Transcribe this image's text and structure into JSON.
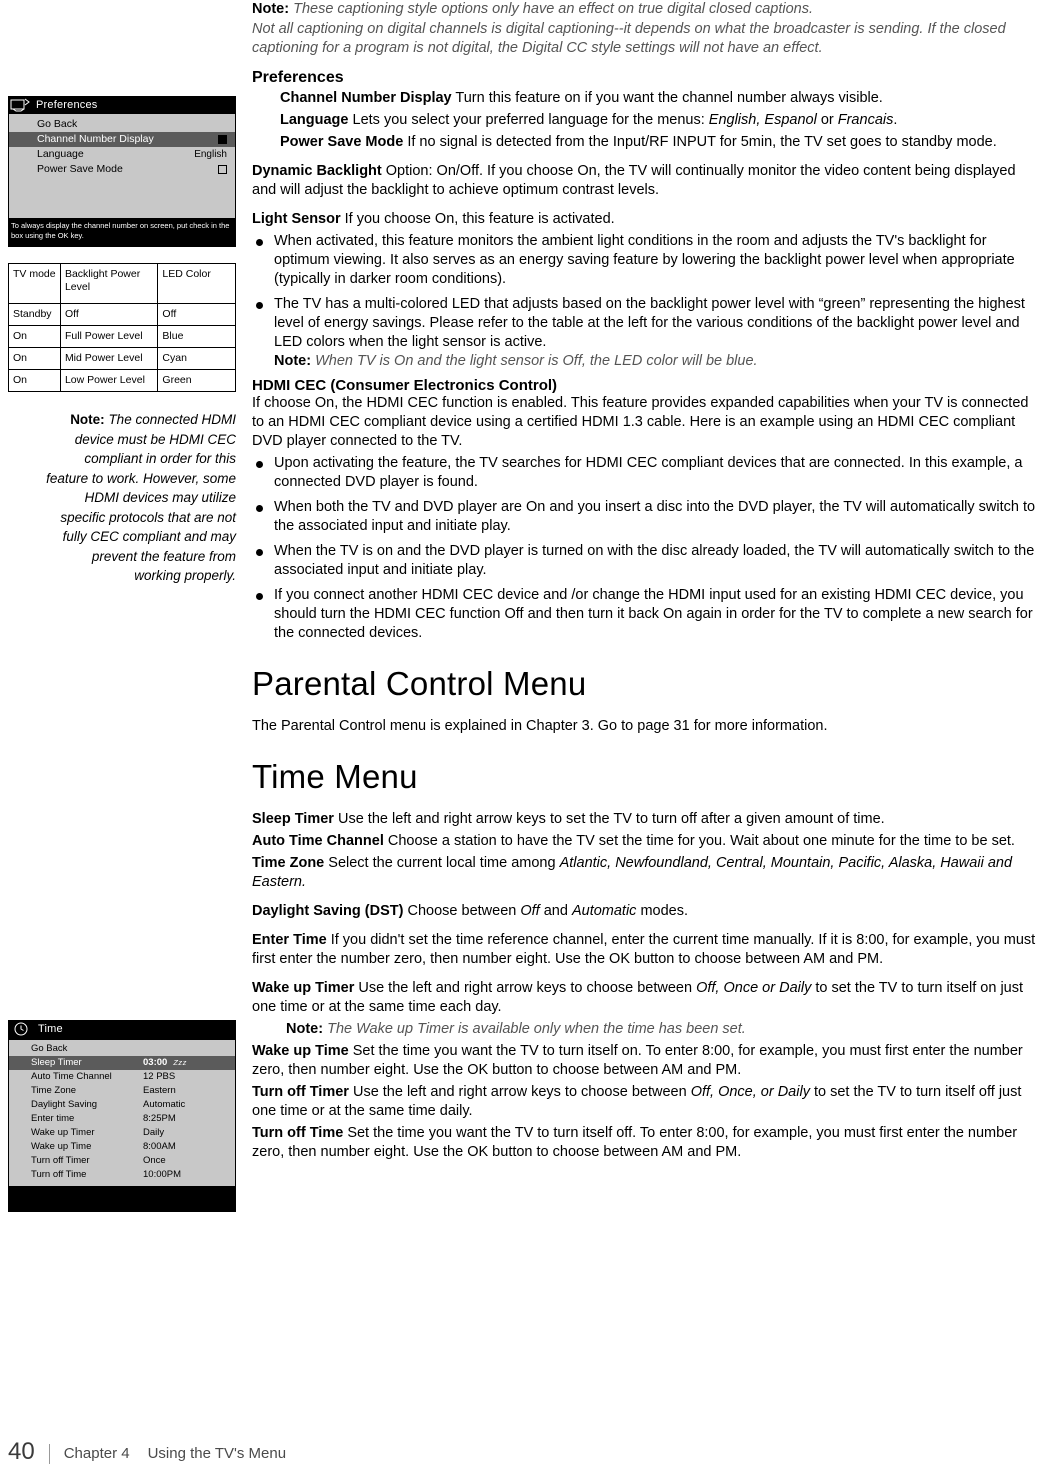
{
  "osd_preferences": {
    "title": "Preferences",
    "icon": "tv-preferences-icon",
    "rows": [
      {
        "label": "Go Back",
        "value": "",
        "selected": false,
        "checkbox": null
      },
      {
        "label": "Channel Number Display",
        "value": "",
        "selected": true,
        "checkbox": "filled"
      },
      {
        "label": "Language",
        "value": "English",
        "selected": false,
        "checkbox": null
      },
      {
        "label": "Power Save Mode",
        "value": "",
        "selected": false,
        "checkbox": "open"
      }
    ],
    "footer": "To always display the channel number on screen, put check in the box using the OK key."
  },
  "tv_table": {
    "headers": [
      "TV mode",
      "Backlight Power Level",
      "LED Color"
    ],
    "rows": [
      [
        "Standby",
        "Off",
        "Off"
      ],
      [
        "On",
        "Full Power Level",
        "Blue"
      ],
      [
        "On",
        "Mid Power Level",
        "Cyan"
      ],
      [
        "On",
        "Low Power Level",
        "Green"
      ]
    ]
  },
  "left_note": {
    "label": "Note:",
    "text": " The connected HDMI device must be HDMI CEC compliant in order for this feature to work. However, some HDMI devices may utilize specific protocols that are not fully CEC compliant and may prevent the feature from working properly."
  },
  "osd_time": {
    "title": "Time",
    "icon": "clock-icon",
    "rows": [
      {
        "key": "Go Back",
        "value": "",
        "selected": false
      },
      {
        "key": "Sleep Timer",
        "value": "03:00",
        "selected": true,
        "suffix": "Zzz"
      },
      {
        "key": "Auto Time Channel",
        "value": "12 PBS",
        "selected": false
      },
      {
        "key": "Time Zone",
        "value": "Eastern",
        "selected": false
      },
      {
        "key": "Daylight Saving",
        "value": "Automatic",
        "selected": false
      },
      {
        "key": "Enter time",
        "value": "8:25PM",
        "selected": false
      },
      {
        "key": "Wake up Timer",
        "value": "Daily",
        "selected": false
      },
      {
        "key": "Wake up Time",
        "value": "8:00AM",
        "selected": false
      },
      {
        "key": "Turn off Timer",
        "value": "Once",
        "selected": false
      },
      {
        "key": "Turn off Time",
        "value": "10:00PM",
        "selected": false
      }
    ]
  },
  "content": {
    "note_top_label": "Note:",
    "note_top_line1": " These captioning style options only have an effect on true digital closed captions.",
    "note_top_line2": "Not all captioning on digital channels is digital captioning--it depends on what the broadcaster is sending. If the closed captioning for a program is not digital, the Digital CC style settings will not have an effect.",
    "preferences_heading": "Preferences",
    "pref_items": [
      {
        "term": "Channel Number Display",
        "desc": "  Turn this feature on if you want the channel number always visible."
      },
      {
        "term": "Language",
        "desc_pre": "   Lets you select your preferred language for the menus: ",
        "desc_it": "English, Espanol",
        "desc_mid": " or ",
        "desc_it2": "Francais",
        "desc_post": "."
      },
      {
        "term": "Power Save Mode",
        "desc": "   If no signal is detected from the Input/RF INPUT for 5min, the TV set goes to standby mode."
      }
    ],
    "dynamic_backlight": {
      "term": "Dynamic Backlight",
      "desc": "   Option: On/Off. If you choose On, the TV will continually monitor the video content being displayed and will adjust the backlight to achieve optimum contrast levels."
    },
    "light_sensor": {
      "term": "Light Sensor",
      "desc": "  If you choose On, this feature is activated.",
      "bullets": [
        "When activated, this feature monitors the ambient light conditions in the room and adjusts the TV's backlight for optimum viewing. It also serves as an energy saving feature by lowering the backlight power level when appropriate (typically in darker room conditions).",
        "The TV has a multi-colored LED that adjusts based on the backlight power level with “green” representing the highest level of energy savings. Please refer to the table at the left for the various conditions of the backlight power level and LED colors when the light sensor is active."
      ],
      "note_label": "Note:",
      "note_text": " When TV is On and the light sensor is Off, the LED color will be blue."
    },
    "hdmi_cec": {
      "heading": "HDMI CEC (Consumer Electronics Control)",
      "intro": "If choose On, the HDMI CEC function is enabled. This feature provides expanded capabilities when your TV is connected to an HDMI CEC compliant device using a certified HDMI 1.3 cable. Here is an example using an HDMI CEC compliant DVD player connected to the TV.",
      "bullets": [
        "Upon activating the feature, the TV searches for HDMI CEC compliant devices that are connected. In this example, a connected DVD player is found.",
        "When both the TV and DVD player are On and you insert a disc into the DVD player, the TV will automatically switch to the associated input and initiate play.",
        "When the TV is on and the DVD player is turned on with the disc already loaded, the TV will automatically switch to the associated input and initiate play.",
        "If you connect another HDMI CEC device and /or change the HDMI input used for an existing HDMI CEC device, you should turn the HDMI CEC function Off and then turn it back On again in order for the TV to complete a new search for the connected devices."
      ]
    },
    "parental_heading": "Parental Control Menu",
    "parental_text": "The Parental Control menu is explained in Chapter 3. Go to page 31 for more information.",
    "time_heading": "Time Menu",
    "time_items": [
      {
        "term": "Sleep Timer",
        "desc": "   Use the left and right arrow keys to set the TV to turn off after a given amount of time."
      },
      {
        "term": "Auto Time Channel",
        "desc": "    Choose a station to have the TV set the time for you. Wait about one minute for the time to be set."
      },
      {
        "term": "Time Zone",
        "desc_pre": "    Select the current local time among ",
        "desc_it": "Atlantic, Newfoundland, Central, Mountain, Pacific, Alaska, Hawaii and Eastern.",
        "desc_post": ""
      },
      {
        "term": "Daylight Saving (DST)",
        "desc_pre": "  Choose between ",
        "desc_it": "Off",
        "desc_mid": " and ",
        "desc_it2": "Automatic",
        "desc_post": " modes."
      },
      {
        "term": "Enter Time",
        "desc": "    If you didn't set the time reference channel, enter the current time manually.   If it is 8:00, for example, you must first enter the number zero, then number eight. Use the OK button to choose between AM and PM."
      },
      {
        "term": "Wake up Timer",
        "desc_pre": "   Use the left and right arrow keys to choose between ",
        "desc_it": "Off, Once or Daily",
        "desc_post": " to set the TV to turn itself on just one time or at the same time each day."
      }
    ],
    "wake_note_label": "Note:",
    "wake_note_text": " The Wake up Timer is available only when the time has been set.",
    "time_items2": [
      {
        "term": "Wake up Time",
        "desc": "    Set the time you want the TV to turn itself on.  To enter 8:00, for example, you must first enter the number zero, then number eight. Use the OK button to choose between AM and PM."
      },
      {
        "term": "Turn off Timer",
        "desc_pre": "  Use the left and right arrow keys to choose between ",
        "desc_it": "Off, Once, or Daily",
        "desc_post": " to set the TV to turn itself off just one time or at the same time daily."
      },
      {
        "term": "Turn off Time",
        "desc": "    Set the time you want the TV to turn itself off.  To enter 8:00, for example, you must first enter the number zero, then number eight. Use the OK button to choose between AM and PM."
      }
    ]
  },
  "footer": {
    "page_number": "40",
    "chapter": "Chapter 4",
    "section": "Using the TV's Menu"
  }
}
